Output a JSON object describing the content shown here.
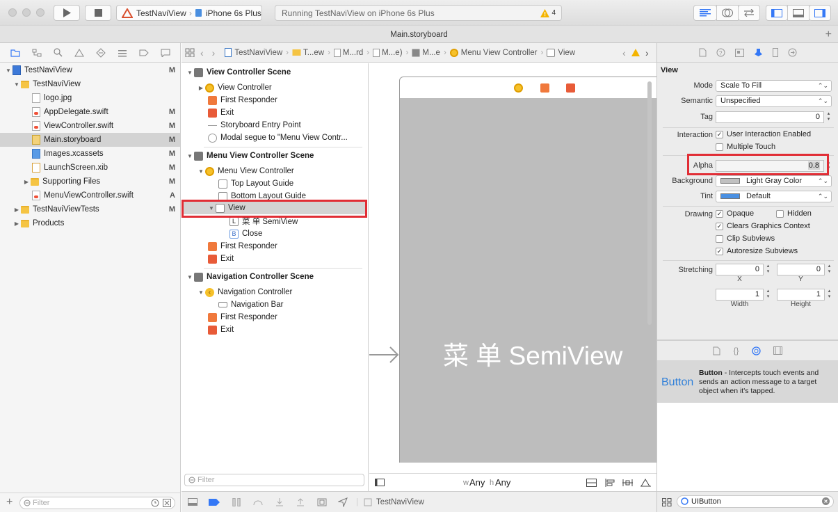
{
  "window": {
    "scheme_project": "TestNaviView",
    "scheme_device": "iPhone 6s Plus",
    "activity_status": "Running TestNaviView on iPhone 6s Plus",
    "warning_count": "4",
    "tab_title": "Main.storyboard"
  },
  "navigator": {
    "items": [
      {
        "label": "TestNaviView",
        "badge": "M"
      },
      {
        "label": "TestNaviView",
        "badge": ""
      },
      {
        "label": "logo.jpg",
        "badge": ""
      },
      {
        "label": "AppDelegate.swift",
        "badge": "M"
      },
      {
        "label": "ViewController.swift",
        "badge": "M"
      },
      {
        "label": "Main.storyboard",
        "badge": "M"
      },
      {
        "label": "Images.xcassets",
        "badge": "M"
      },
      {
        "label": "LaunchScreen.xib",
        "badge": "M"
      },
      {
        "label": "Supporting Files",
        "badge": "M"
      },
      {
        "label": "MenuViewController.swift",
        "badge": "A"
      },
      {
        "label": "TestNaviViewTests",
        "badge": "M"
      },
      {
        "label": "Products",
        "badge": ""
      }
    ],
    "filter_placeholder": "Filter"
  },
  "jumpbar": {
    "crumbs": [
      "TestNaviView",
      "T...ew",
      "M...rd",
      "M...e)",
      "M...e",
      "Menu View Controller",
      "View"
    ]
  },
  "outline": {
    "scene1_title": "View Controller Scene",
    "scene1_items": [
      "View Controller",
      "First Responder",
      "Exit",
      "Storyboard Entry Point",
      "Modal segue to \"Menu View Contr..."
    ],
    "scene2_title": "Menu View Controller Scene",
    "scene2_items": [
      "Menu View Controller",
      "Top Layout Guide",
      "Bottom Layout Guide",
      "View",
      "菜  单 SemiView",
      "Close",
      "First Responder",
      "Exit"
    ],
    "scene3_title": "Navigation Controller Scene",
    "scene3_items": [
      "Navigation Controller",
      "Navigation Bar",
      "First Responder",
      "Exit"
    ],
    "filter_placeholder": "Filter"
  },
  "canvas": {
    "label_text": "菜  单 SemiView",
    "size_class_w": "Any",
    "size_class_h": "Any",
    "w_prefix": "w",
    "h_prefix": "h"
  },
  "bottom_bar": {
    "target": "TestNaviView"
  },
  "inspector": {
    "section_title": "View",
    "mode_label": "Mode",
    "mode_value": "Scale To Fill",
    "semantic_label": "Semantic",
    "semantic_value": "Unspecified",
    "tag_label": "Tag",
    "tag_value": "0",
    "interaction_label": "Interaction",
    "user_interaction": "User Interaction Enabled",
    "multiple_touch": "Multiple Touch",
    "alpha_label": "Alpha",
    "alpha_value": "0.8",
    "background_label": "Background",
    "background_value": "Light Gray Color",
    "tint_label": "Tint",
    "tint_value": "Default",
    "drawing_label": "Drawing",
    "opaque": "Opaque",
    "hidden": "Hidden",
    "clears_graphics": "Clears Graphics Context",
    "clip_subviews": "Clip Subviews",
    "autoresize_subviews": "Autoresize Subviews",
    "stretching_label": "Stretching",
    "stretch_x": "0",
    "stretch_y": "0",
    "stretch_w": "1",
    "stretch_h": "1",
    "x_label": "X",
    "y_label": "Y",
    "width_label": "Width",
    "height_label": "Height",
    "background_color": "#c0c0c0",
    "tint_color": "#4a90e2"
  },
  "library": {
    "item_title": "Button",
    "item_name": "Button",
    "item_description": " - Intercepts touch events and sends an action message to a target object when it's tapped.",
    "search_value": "UIButton"
  },
  "colors": {
    "highlight": "#e12d35",
    "selection": "#d3d3d3",
    "accent": "#2f7fd9"
  }
}
